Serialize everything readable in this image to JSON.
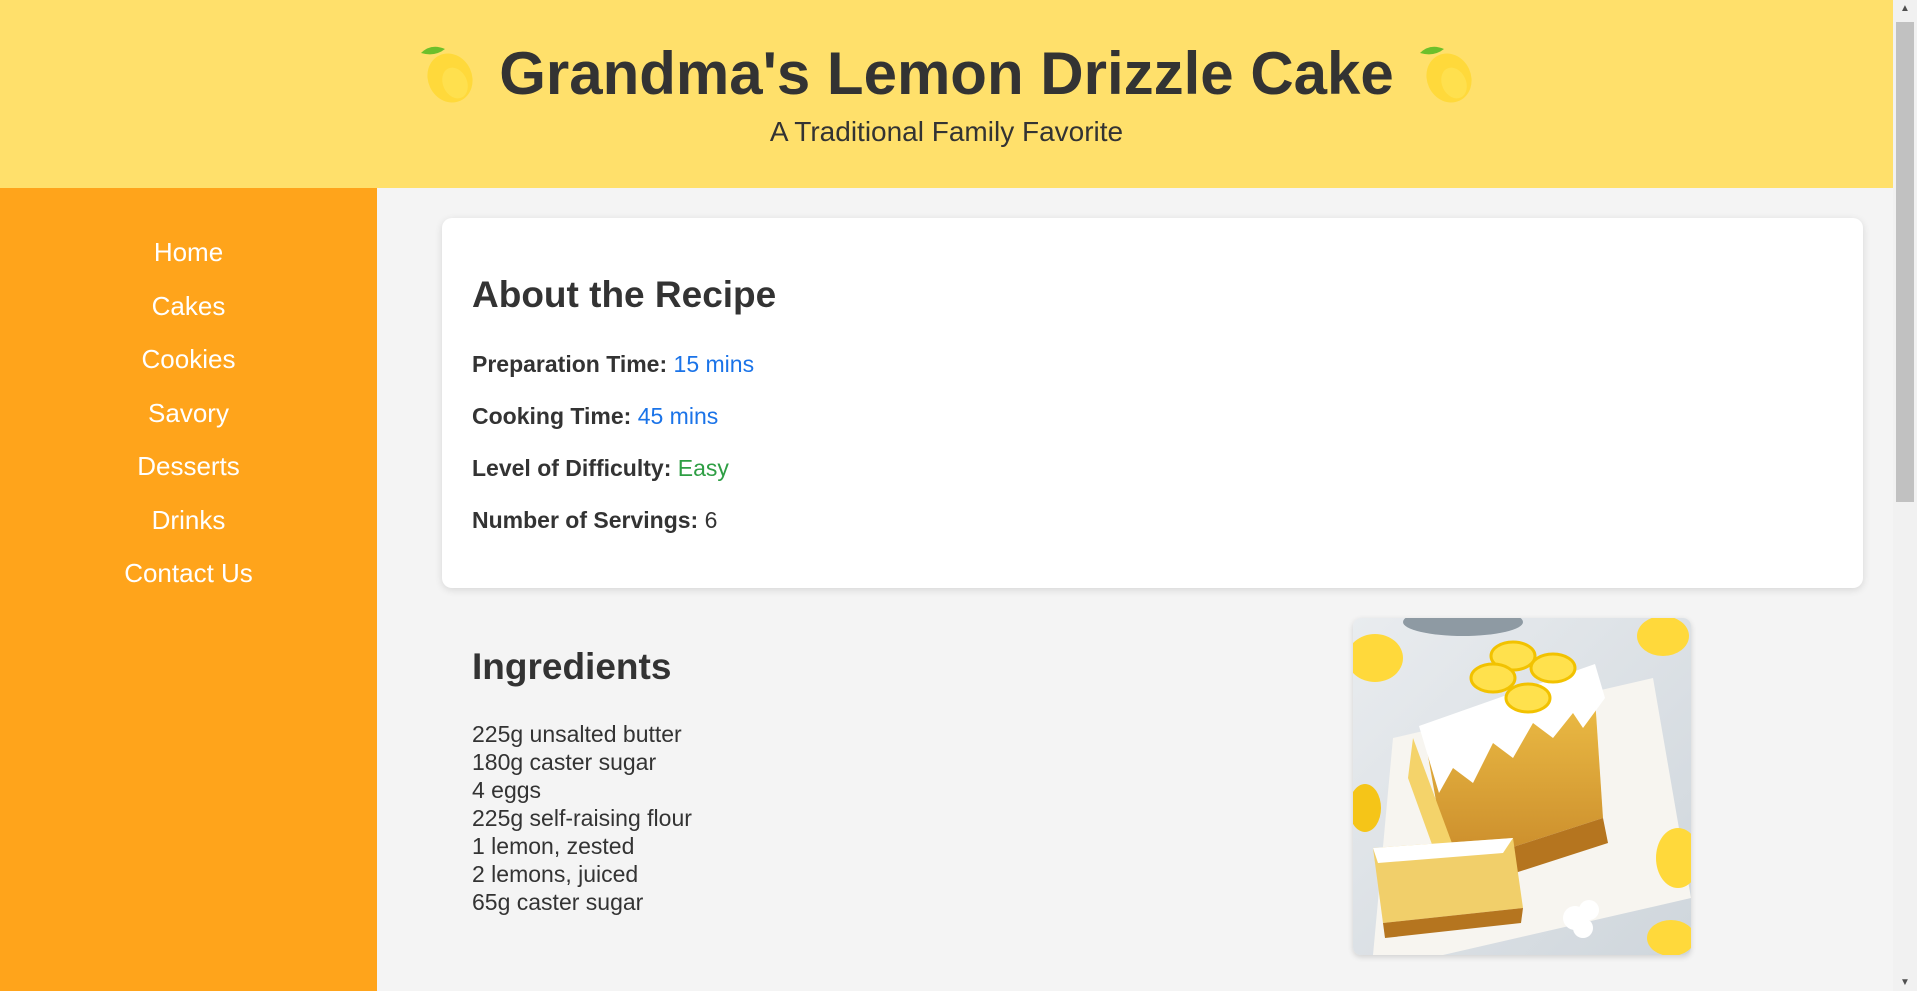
{
  "header": {
    "title": "Grandma's Lemon Drizzle Cake",
    "subtitle": "A Traditional Family Favorite",
    "decoration_icon": "lemon-icon"
  },
  "sidebar": {
    "items": [
      {
        "label": "Home"
      },
      {
        "label": "Cakes"
      },
      {
        "label": "Cookies"
      },
      {
        "label": "Savory"
      },
      {
        "label": "Desserts"
      },
      {
        "label": "Drinks"
      },
      {
        "label": "Contact Us"
      }
    ]
  },
  "about": {
    "heading": "About the Recipe",
    "prep_label": "Preparation Time:",
    "prep_value": "15 mins",
    "cook_label": "Cooking Time:",
    "cook_value": "45 mins",
    "difficulty_label": "Level of Difficulty:",
    "difficulty_value": "Easy",
    "servings_label": "Number of Servings:",
    "servings_value": "6"
  },
  "ingredients": {
    "heading": "Ingredients",
    "items": [
      "225g unsalted butter",
      "180g caster sugar",
      "4 eggs",
      "225g self-raising flour",
      "1 lemon, zested",
      "2 lemons, juiced",
      "65g caster sugar"
    ],
    "image_subject": "lemon drizzle cake photo"
  },
  "colors": {
    "header_bg": "#ffe06b",
    "sidebar_bg": "#ffa41b",
    "page_bg": "#f4f4f4",
    "time_value": "#1a73e8",
    "difficulty_value": "#2e9e44",
    "text": "#333333"
  }
}
